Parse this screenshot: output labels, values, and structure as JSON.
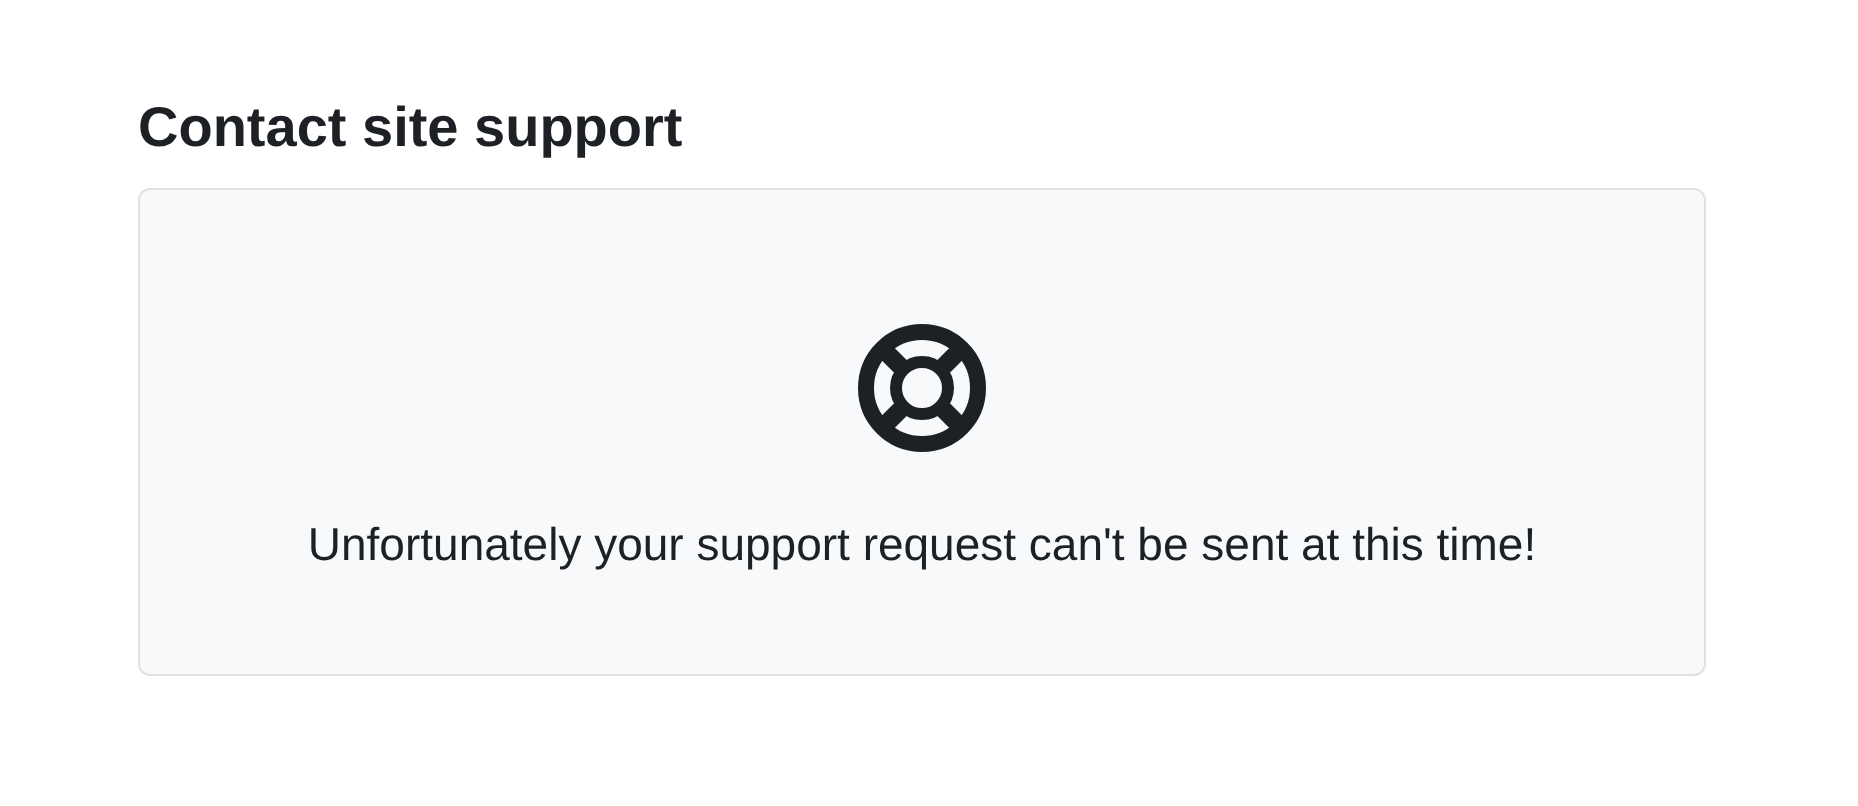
{
  "heading": "Contact site support",
  "notice": {
    "message": "Unfortunately your support request can't be sent at this time!"
  }
}
